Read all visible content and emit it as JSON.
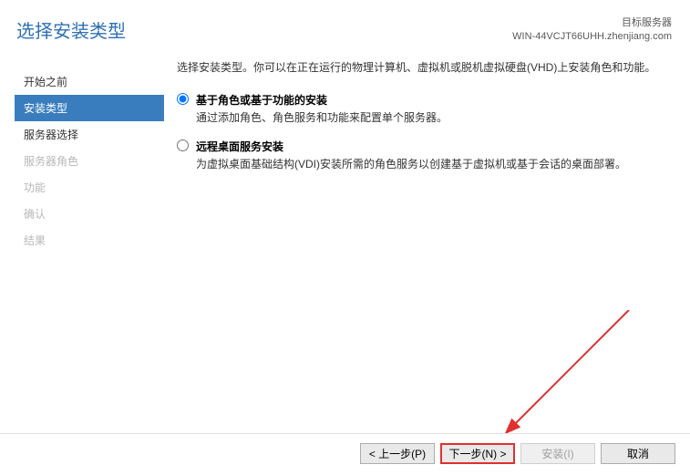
{
  "header": {
    "title": "选择安装类型",
    "target_label": "目标服务器",
    "target_server": "WIN-44VCJT66UHH.zhenjiang.com"
  },
  "sidebar": {
    "items": [
      {
        "label": "开始之前",
        "state": "normal"
      },
      {
        "label": "安装类型",
        "state": "active"
      },
      {
        "label": "服务器选择",
        "state": "normal"
      },
      {
        "label": "服务器角色",
        "state": "disabled"
      },
      {
        "label": "功能",
        "state": "disabled"
      },
      {
        "label": "确认",
        "state": "disabled"
      },
      {
        "label": "结果",
        "state": "disabled"
      }
    ]
  },
  "content": {
    "intro": "选择安装类型。你可以在正在运行的物理计算机、虚拟机或脱机虚拟硬盘(VHD)上安装角色和功能。",
    "options": [
      {
        "title": "基于角色或基于功能的安装",
        "desc": "通过添加角色、角色服务和功能来配置单个服务器。",
        "selected": true
      },
      {
        "title": "远程桌面服务安装",
        "desc": "为虚拟桌面基础结构(VDI)安装所需的角色服务以创建基于虚拟机或基于会话的桌面部署。",
        "selected": false
      }
    ]
  },
  "footer": {
    "prev": "< 上一步(P)",
    "next": "下一步(N) >",
    "install": "安装(I)",
    "cancel": "取消"
  }
}
